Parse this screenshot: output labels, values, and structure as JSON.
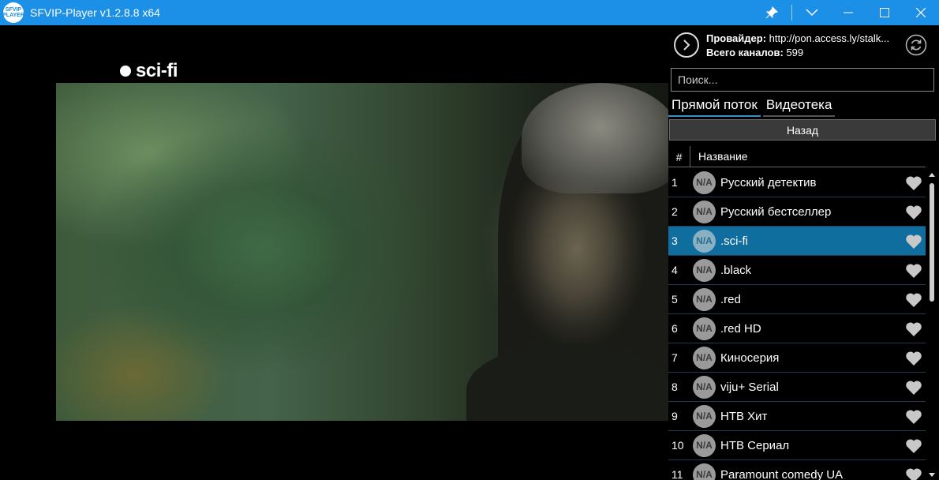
{
  "window": {
    "title": "SFVIP-Player v1.2.8.8 x64",
    "logo_text": "SFVIP PLAYER"
  },
  "overlay": {
    "channel_logo": "sci-fi"
  },
  "provider": {
    "label": "Провайдер:",
    "value": "http://pon.access.ly/stalk...",
    "total_label": "Всего каналов:",
    "total_value": "599"
  },
  "search": {
    "placeholder": "Поиск..."
  },
  "tabs": [
    {
      "label": "Прямой поток",
      "active": true
    },
    {
      "label": "Видеотека",
      "active": false
    }
  ],
  "back_button": "Назад",
  "list": {
    "header_num": "#",
    "header_name": "Название",
    "na_text": "N/A",
    "selected_index": 2,
    "rows": [
      {
        "num": "1",
        "name": "Русский детектив"
      },
      {
        "num": "2",
        "name": "Русский бестселлер"
      },
      {
        "num": "3",
        "name": ".sci-fi"
      },
      {
        "num": "4",
        "name": ".black"
      },
      {
        "num": "5",
        "name": ".red"
      },
      {
        "num": "6",
        "name": ".red HD"
      },
      {
        "num": "7",
        "name": "Киносерия"
      },
      {
        "num": "8",
        "name": "viju+ Serial"
      },
      {
        "num": "9",
        "name": "НТВ Хит"
      },
      {
        "num": "10",
        "name": "НТВ Сериал"
      },
      {
        "num": "11",
        "name": "Paramount comedy UA"
      }
    ]
  },
  "colors": {
    "titlebar": "#1c8fe6",
    "selected_row": "#0f6e9e",
    "active_tab_underline": "#3a8fc7"
  },
  "icons": {
    "pin": "pin-icon",
    "dropdown": "chevron-down-icon",
    "minimize": "minimize-icon",
    "maximize": "maximize-icon",
    "close": "close-icon",
    "provider_next": "arrow-right-circle-icon",
    "refresh": "refresh-icon",
    "favorite": "heart-icon"
  }
}
